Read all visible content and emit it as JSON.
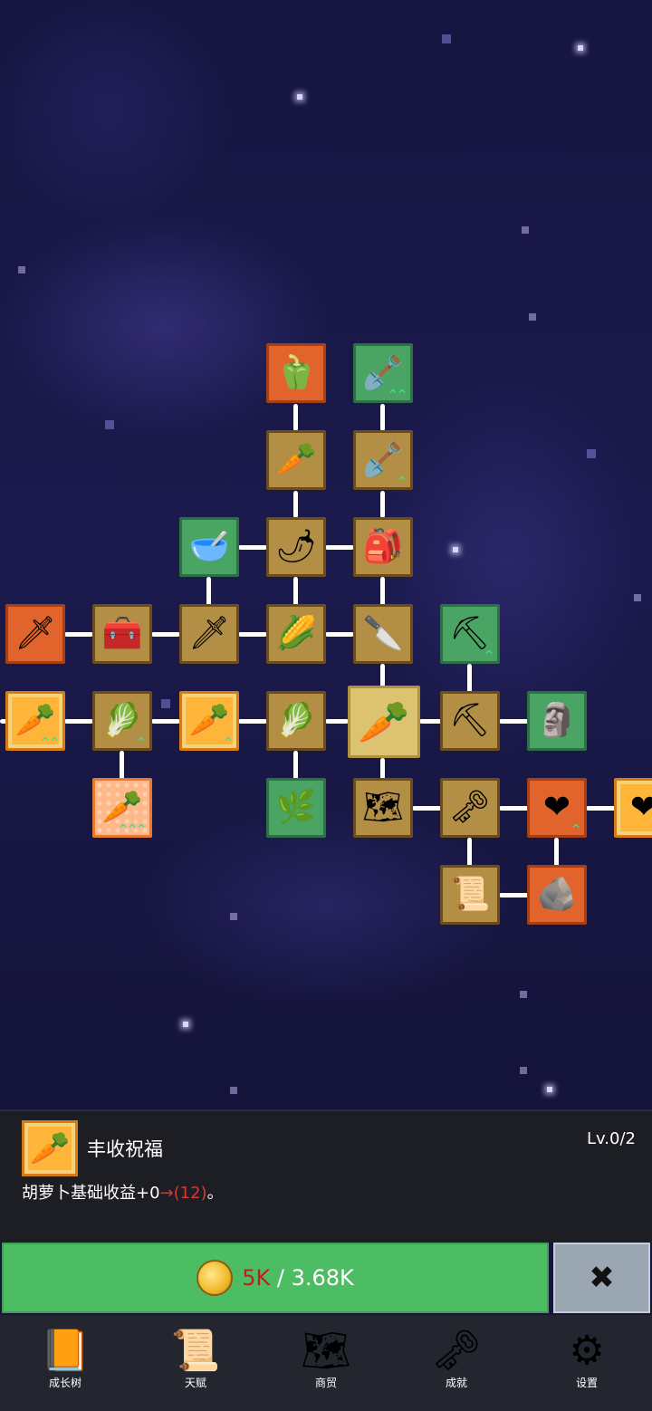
{
  "tree": {
    "nodes": [
      {
        "id": "n1",
        "icon": "pepper-icon",
        "glyph": "🫑",
        "style": "orange"
      },
      {
        "id": "n2",
        "icon": "shovel-icon",
        "glyph": "🪏",
        "style": "green",
        "up": "^^"
      },
      {
        "id": "n3",
        "icon": "radish-icon",
        "glyph": "🥕",
        "style": "tan"
      },
      {
        "id": "n4",
        "icon": "shovel-icon",
        "glyph": "🪏",
        "style": "tan",
        "up": "^"
      },
      {
        "id": "n5",
        "icon": "bowl-icon",
        "glyph": "🥣",
        "style": "green"
      },
      {
        "id": "n6",
        "icon": "chili-icon",
        "glyph": "🌶",
        "style": "tan"
      },
      {
        "id": "n7",
        "icon": "backpack-icon",
        "glyph": "🎒",
        "style": "tan"
      },
      {
        "id": "n8",
        "icon": "sword-icon",
        "glyph": "🗡",
        "style": "orange"
      },
      {
        "id": "n9",
        "icon": "chest-icon",
        "glyph": "🧰",
        "style": "tan"
      },
      {
        "id": "n10",
        "icon": "sword-icon",
        "glyph": "🗡",
        "style": "tan"
      },
      {
        "id": "n11",
        "icon": "corn-icon",
        "glyph": "🌽",
        "style": "tan"
      },
      {
        "id": "n12",
        "icon": "knife-icon",
        "glyph": "🔪",
        "style": "tan"
      },
      {
        "id": "n13",
        "icon": "pickaxe-icon",
        "glyph": "⛏",
        "style": "green",
        "up": "^"
      },
      {
        "id": "n14",
        "icon": "carrot-icon",
        "glyph": "🥕",
        "style": "gold",
        "up": "^^"
      },
      {
        "id": "n15",
        "icon": "cabbage-icon",
        "glyph": "🥬",
        "style": "tan",
        "up": "^"
      },
      {
        "id": "n16",
        "icon": "carrot-icon",
        "glyph": "🥕",
        "style": "gold",
        "up": "^"
      },
      {
        "id": "n17",
        "icon": "cabbage-icon",
        "glyph": "🥬",
        "style": "tan"
      },
      {
        "id": "n18",
        "icon": "carrot-icon",
        "glyph": "🥕",
        "style": "selected"
      },
      {
        "id": "n19",
        "icon": "pickaxe-icon",
        "glyph": "⛏",
        "style": "tan"
      },
      {
        "id": "n20",
        "icon": "statue-icon",
        "glyph": "🗿",
        "style": "green"
      },
      {
        "id": "n21",
        "icon": "carrot-icon",
        "glyph": "🥕",
        "style": "gold-check",
        "up": "^^^"
      },
      {
        "id": "n22",
        "icon": "root-icon",
        "glyph": "🌿",
        "style": "green"
      },
      {
        "id": "n23",
        "icon": "map-icon",
        "glyph": "🗺",
        "style": "tan"
      },
      {
        "id": "n24",
        "icon": "key-icon",
        "glyph": "🗝",
        "style": "tan"
      },
      {
        "id": "n25",
        "icon": "heart-icon",
        "glyph": "❤",
        "style": "orange",
        "up": "^"
      },
      {
        "id": "n26",
        "icon": "heart-icon",
        "glyph": "❤",
        "style": "gold"
      },
      {
        "id": "n27",
        "icon": "scroll-icon",
        "glyph": "📜",
        "style": "tan"
      },
      {
        "id": "n28",
        "icon": "rock-icon",
        "glyph": "🪨",
        "style": "orange"
      }
    ]
  },
  "panel": {
    "icon_glyph": "🥕",
    "name": "丰收祝福",
    "level": "Lv.0/2",
    "desc_prefix": "胡萝卜基础收益+0",
    "desc_arrow": "→(12)",
    "desc_suffix": "。"
  },
  "upgrade": {
    "cost": "5K",
    "separator": " / ",
    "balance": "3.68K",
    "close_label": "✖"
  },
  "navbar": {
    "items": [
      {
        "label": "成长树",
        "icon": "book-icon",
        "glyph": "📙"
      },
      {
        "label": "天赋",
        "icon": "scroll-icon",
        "glyph": "📜"
      },
      {
        "label": "商贸",
        "icon": "map-icon",
        "glyph": "🗺"
      },
      {
        "label": "成就",
        "icon": "key-icon",
        "glyph": "🗝"
      },
      {
        "label": "设置",
        "icon": "gear-icon",
        "glyph": "⚙"
      }
    ]
  },
  "colors": {
    "accent_green": "#4cbd62",
    "node_tan": "#b28f45",
    "node_orange": "#e0642c",
    "node_green": "#4aa564",
    "cost_red": "#c21d1d"
  }
}
